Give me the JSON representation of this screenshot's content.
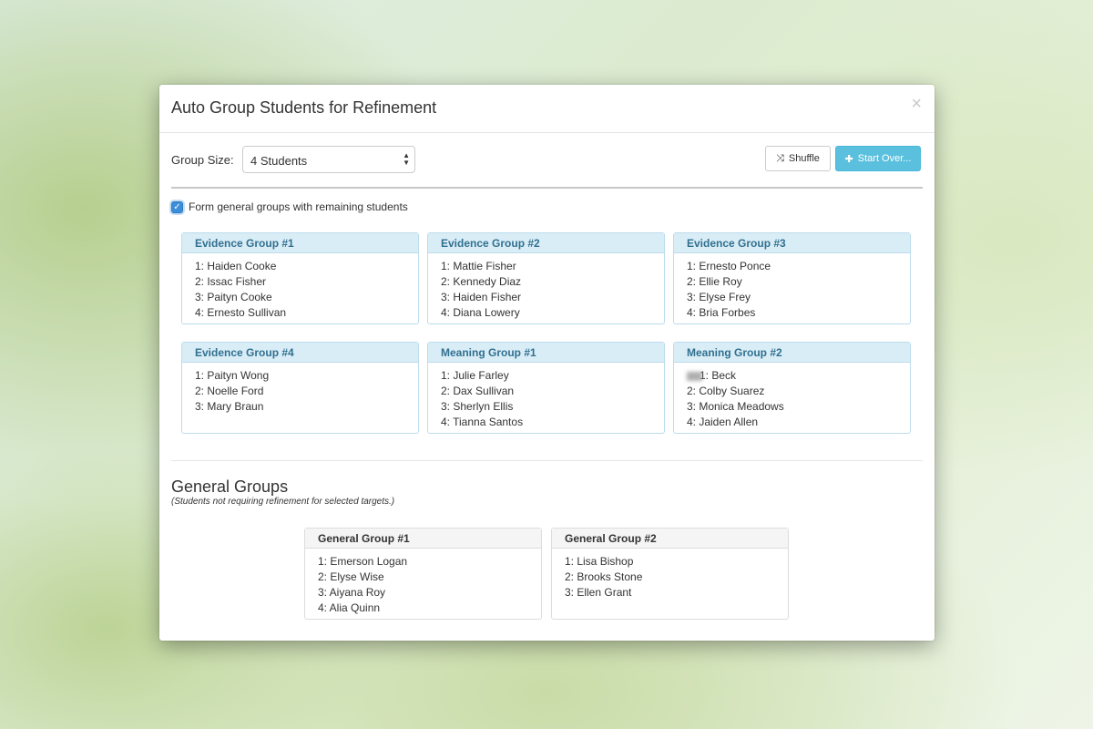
{
  "modal": {
    "title": "Auto Group Students for Refinement",
    "close_label": "×"
  },
  "controls": {
    "group_size_label": "Group Size:",
    "group_size_value": "4 Students",
    "shuffle_label": "Shuffle",
    "start_over_label": "Start Over..."
  },
  "checkbox": {
    "label": "Form general groups with remaining students",
    "checked": true
  },
  "refinement_groups": [
    {
      "title": "Evidence Group #1",
      "members": [
        "1: Haiden Cooke",
        "2: Issac Fisher",
        "3: Paityn Cooke",
        "4: Ernesto Sullivan"
      ]
    },
    {
      "title": "Evidence Group #2",
      "members": [
        "1: Mattie Fisher",
        "2: Kennedy Diaz",
        "3: Haiden Fisher",
        "4: Diana Lowery"
      ]
    },
    {
      "title": "Evidence Group #3",
      "members": [
        "1: Ernesto Ponce",
        "2: Ellie Roy",
        "3: Elyse Frey",
        "4: Bria Forbes"
      ]
    },
    {
      "title": "Evidence Group #4",
      "members": [
        "1: Paityn Wong",
        "2: Noelle Ford",
        "3: Mary Braun"
      ]
    },
    {
      "title": "Meaning Group #1",
      "members": [
        "1: Julie Farley",
        "2: Dax Sullivan",
        "3: Sherlyn Ellis",
        "4: Tianna Santos"
      ]
    },
    {
      "title": "Meaning Group #2",
      "members": [
        "1:  Beck",
        "2: Colby Suarez",
        "3: Monica Meadows",
        "4: Jaiden Allen"
      ]
    }
  ],
  "general": {
    "title": "General Groups",
    "subtitle": "(Students not requiring refinement for selected targets.)",
    "groups": [
      {
        "title": "General Group #1",
        "members": [
          "1: Emerson Logan",
          "2: Elyse Wise",
          "3: Aiyana Roy",
          "4: Alia Quinn"
        ]
      },
      {
        "title": "General Group #2",
        "members": [
          "1: Lisa Bishop",
          "2: Brooks Stone",
          "3: Ellen Grant"
        ]
      }
    ]
  }
}
